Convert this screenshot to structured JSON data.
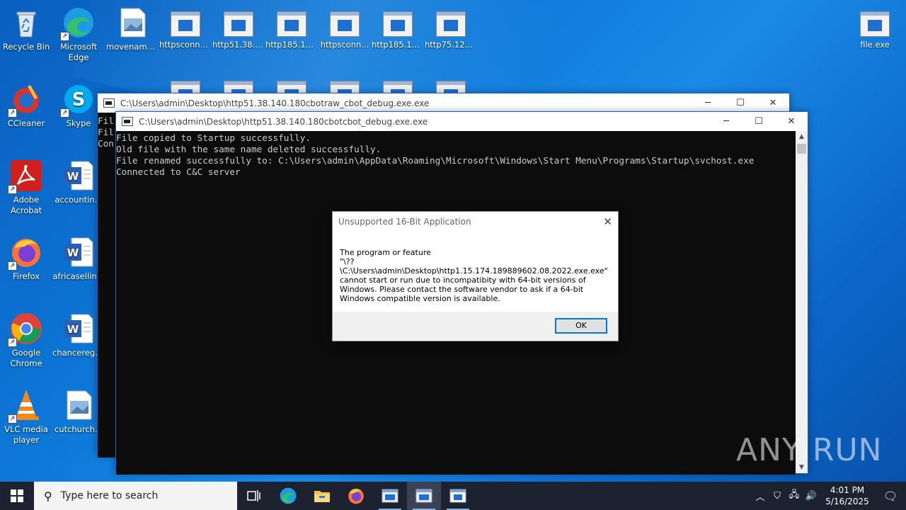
{
  "desktop": {
    "icons_col1": [
      {
        "label": "Recycle Bin"
      },
      {
        "label": "CCleaner"
      },
      {
        "label": "Adobe Acrobat"
      },
      {
        "label": "Firefox"
      },
      {
        "label": "Google Chrome"
      },
      {
        "label": "VLC media player"
      }
    ],
    "icons_col2": [
      {
        "label": "Microsoft Edge"
      },
      {
        "label": "Skype"
      },
      {
        "label": "accountin..."
      },
      {
        "label": "africasellin..."
      },
      {
        "label": "chanceregi..."
      },
      {
        "label": "cutchurch..."
      }
    ],
    "top_row": [
      {
        "label": "movename..."
      },
      {
        "label": "httpsconne..."
      },
      {
        "label": "http51.38.1..."
      },
      {
        "label": "http185.156..."
      },
      {
        "label": "httpsconn..."
      },
      {
        "label": "http185.156..."
      },
      {
        "label": "http75.127...."
      }
    ],
    "right_icon": {
      "label": "file.exe"
    }
  },
  "window_back": {
    "title": "C:\\Users\\admin\\Desktop\\http51.38.140.180cbotraw_cbot_debug.exe.exe",
    "visible_lines": [
      "Fil",
      "Fil",
      "Con"
    ]
  },
  "window_front": {
    "title": "C:\\Users\\admin\\Desktop\\http51.38.140.180cbotcbot_debug.exe.exe",
    "lines": [
      "File copied to Startup successfully.",
      "Old file with the same name deleted successfully.",
      "File renamed successfully to: C:\\Users\\admin\\AppData\\Roaming\\Microsoft\\Windows\\Start Menu\\Programs\\Startup\\svchost.exe",
      "Connected to C&C server"
    ]
  },
  "dialog": {
    "title": "Unsupported 16-Bit Application",
    "message_lines": [
      "The program or feature",
      "\"\\??\\C:\\Users\\admin\\Desktop\\http1.15.174.189889602.08.2022.exe.exe\"",
      "cannot start or run due to incompatibity with 64-bit versions of",
      "Windows. Please contact the software vendor to ask if a 64-bit",
      "Windows compatible version is available."
    ],
    "ok_label": "OK"
  },
  "taskbar": {
    "search_placeholder": "Type here to search",
    "time": "4:01 PM",
    "date": "5/16/2025"
  },
  "watermark": "ANY RUN"
}
